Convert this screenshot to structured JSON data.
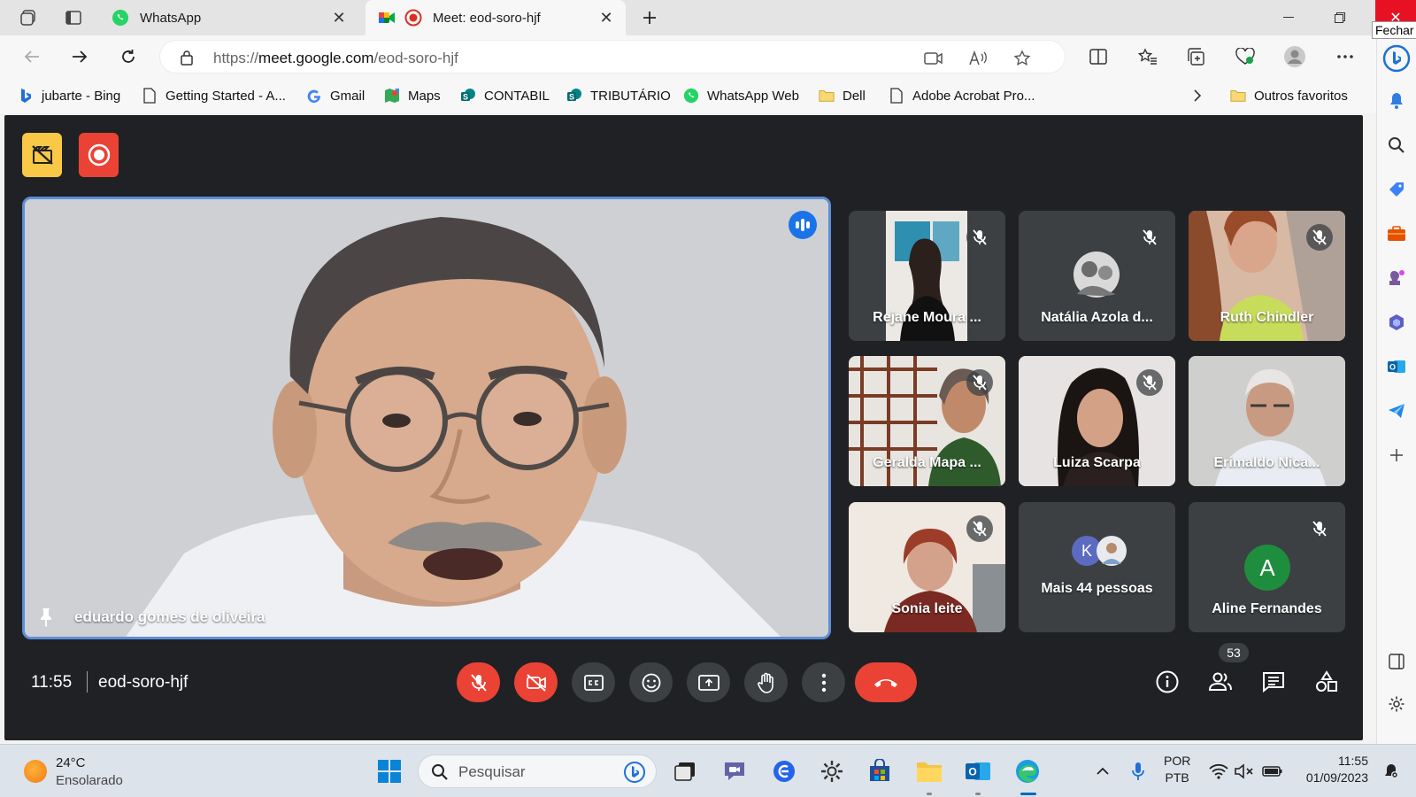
{
  "browser": {
    "tabs": [
      {
        "title": "WhatsApp",
        "active": false
      },
      {
        "title": "Meet: eod-soro-hjf",
        "active": true
      }
    ],
    "close_tooltip": "Fechar",
    "url_prefix": "https://",
    "url_domain": "meet.google.com",
    "url_path": "/eod-soro-hjf",
    "bookmarks": [
      {
        "label": "jubarte - Bing",
        "icon": "bing-icon"
      },
      {
        "label": "Getting Started - A...",
        "icon": "page-icon"
      },
      {
        "label": "Gmail",
        "icon": "google-icon"
      },
      {
        "label": "Maps",
        "icon": "maps-icon"
      },
      {
        "label": "CONTABIL",
        "icon": "sharepoint-icon"
      },
      {
        "label": "TRIBUTÁRIO",
        "icon": "sharepoint-icon"
      },
      {
        "label": "WhatsApp Web",
        "icon": "whatsapp-icon"
      },
      {
        "label": "Dell",
        "icon": "folder-icon"
      },
      {
        "label": "Adobe Acrobat Pro...",
        "icon": "page-icon"
      }
    ],
    "other_favorites": "Outros favoritos"
  },
  "meet": {
    "main_speaker": "eduardo gomes de oliveira",
    "participants": [
      {
        "name": "Rejane Moura ...",
        "muted": true
      },
      {
        "name": "Natália Azola d...",
        "muted": true
      },
      {
        "name": "Ruth Chindler",
        "muted": true
      },
      {
        "name": "Geralda Mapa ...",
        "muted": true
      },
      {
        "name": "Luiza Scarpa",
        "muted": true
      },
      {
        "name": "Erimaldo Nica...",
        "muted": false
      },
      {
        "name": "Sonia leite",
        "muted": true
      },
      {
        "name": "Mais 44 pessoas",
        "muted": false
      },
      {
        "name": "Aline Fernandes",
        "muted": true
      }
    ],
    "more_avatar_letter": "K",
    "aline_avatar_letter": "A",
    "time": "11:55",
    "meeting_code": "eod-soro-hjf",
    "people_count": "53",
    "colors": {
      "red": "#ea4335",
      "blue": "#1a73e8",
      "dark": "#202124",
      "tile": "#3c4043"
    }
  },
  "taskbar": {
    "temperature": "24°C",
    "condition": "Ensolarado",
    "search_placeholder": "Pesquisar",
    "lang_top": "POR",
    "lang_bottom": "PTB",
    "time": "11:55",
    "date": "01/09/2023"
  }
}
